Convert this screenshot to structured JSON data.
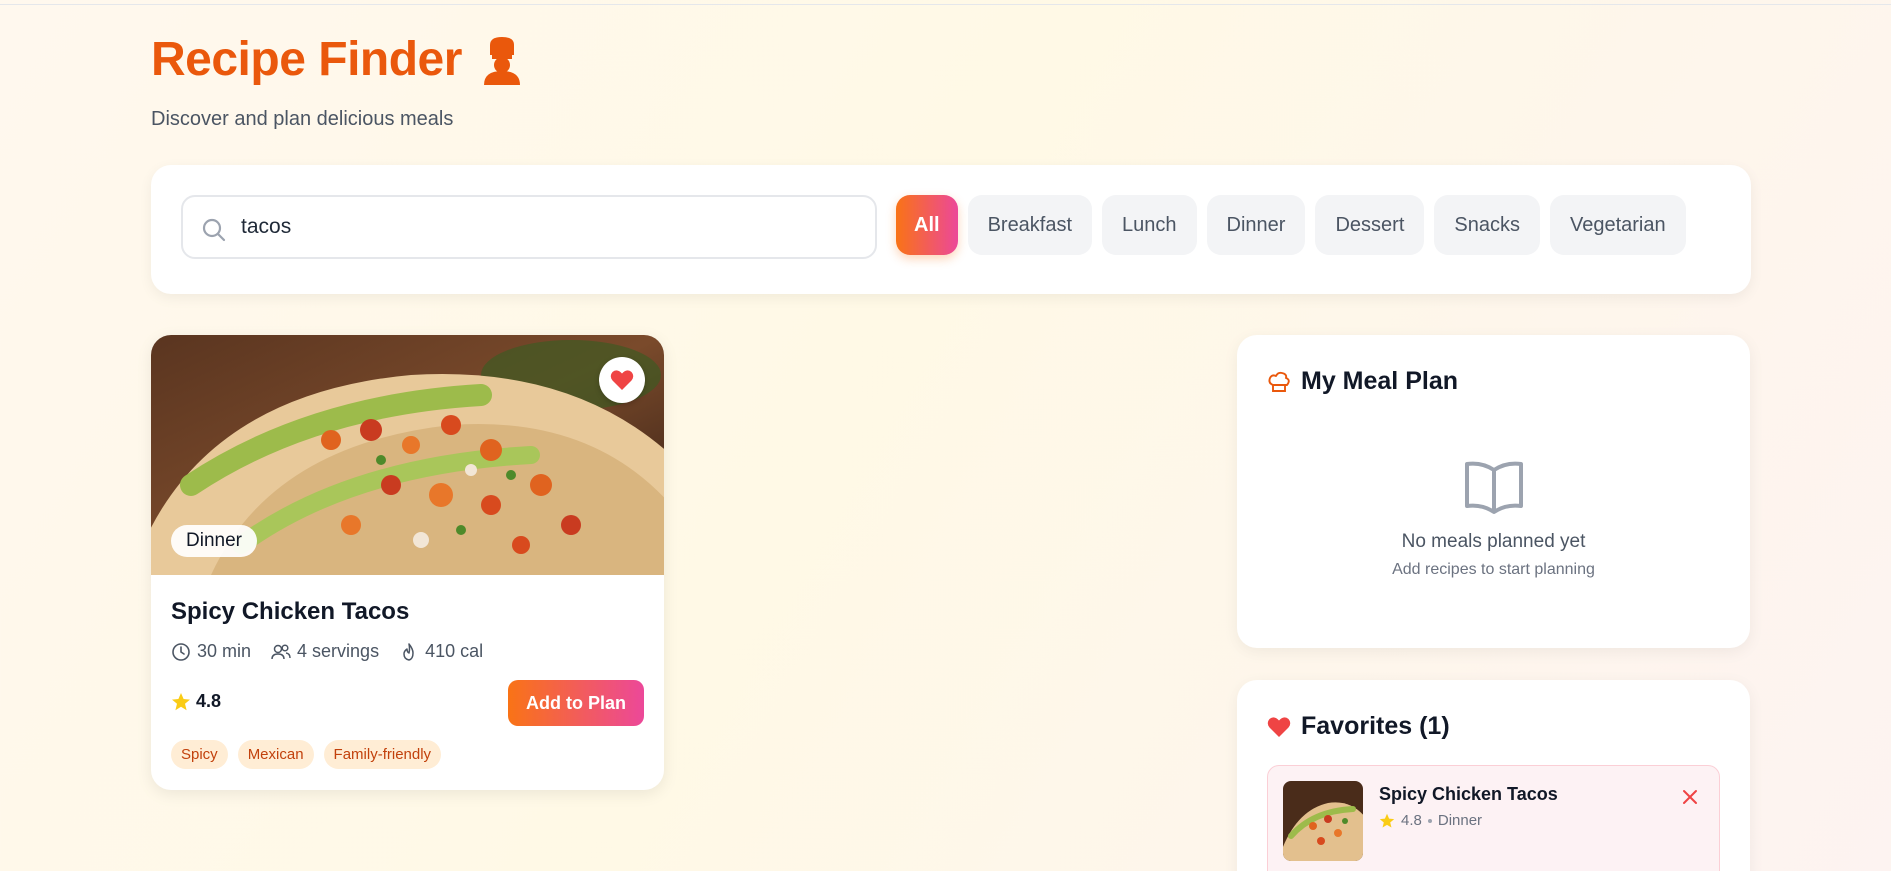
{
  "app": {
    "title": "Recipe Finder",
    "subtitle": "Discover and plan delicious meals",
    "logo_icon": "chef-icon",
    "accent_color": "#ea580c"
  },
  "search": {
    "value": "tacos",
    "icon": "search-icon"
  },
  "filters": [
    {
      "label": "All",
      "active": true
    },
    {
      "label": "Breakfast",
      "active": false
    },
    {
      "label": "Lunch",
      "active": false
    },
    {
      "label": "Dinner",
      "active": false
    },
    {
      "label": "Dessert",
      "active": false
    },
    {
      "label": "Snacks",
      "active": false
    },
    {
      "label": "Vegetarian",
      "active": false
    }
  ],
  "recipes": [
    {
      "title": "Spicy Chicken Tacos",
      "category": "Dinner",
      "time": "30 min",
      "servings": "4 servings",
      "calories": "410 cal",
      "rating": "4.8",
      "add_label": "Add to Plan",
      "favorited": true,
      "tags": [
        "Spicy",
        "Mexican",
        "Family-friendly"
      ]
    }
  ],
  "meal_plan": {
    "title": "My Meal Plan",
    "icon": "chef-hat-icon",
    "empty_title": "No meals planned yet",
    "empty_subtitle": "Add recipes to start planning"
  },
  "favorites": {
    "title": "Favorites (1)",
    "icon": "heart-icon",
    "items": [
      {
        "name": "Spicy Chicken Tacos",
        "rating": "4.8",
        "category": "Dinner"
      }
    ]
  }
}
